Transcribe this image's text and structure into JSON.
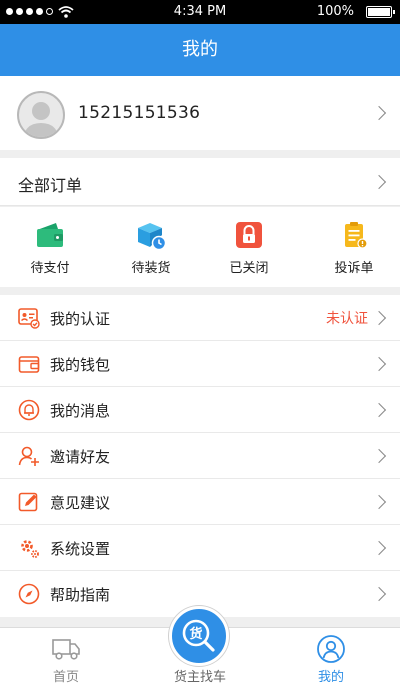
{
  "status_bar": {
    "time": "4:34 PM",
    "battery": "100%"
  },
  "nav": {
    "title": "我的"
  },
  "profile": {
    "phone": "15215151536"
  },
  "orders": {
    "title": "全部订单",
    "items": [
      {
        "label": "待支付",
        "icon": "wallet-icon"
      },
      {
        "label": "待装货",
        "icon": "package-clock-icon"
      },
      {
        "label": "已关闭",
        "icon": "lock-icon"
      },
      {
        "label": "投诉单",
        "icon": "clipboard-icon"
      }
    ]
  },
  "menu": [
    {
      "label": "我的认证",
      "value": "未认证",
      "icon": "id-card-icon"
    },
    {
      "label": "我的钱包",
      "value": "",
      "icon": "wallet-outline-icon"
    },
    {
      "label": "我的消息",
      "value": "",
      "icon": "bell-icon"
    },
    {
      "label": "邀请好友",
      "value": "",
      "icon": "add-user-icon"
    },
    {
      "label": "意见建议",
      "value": "",
      "icon": "edit-icon"
    },
    {
      "label": "系统设置",
      "value": "",
      "icon": "gear-icon"
    },
    {
      "label": "帮助指南",
      "value": "",
      "icon": "compass-icon"
    }
  ],
  "tabbar": {
    "home": "首页",
    "center_glyph": "货",
    "center": "货主找车",
    "mine": "我的"
  },
  "colors": {
    "primary": "#2f8fe6",
    "accent": "#f0533d",
    "icon_orange": "#f25a2a"
  }
}
